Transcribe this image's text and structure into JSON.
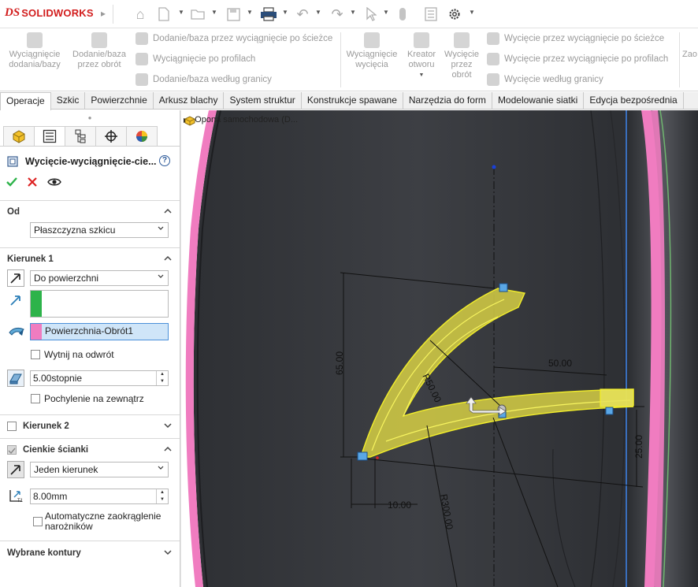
{
  "app": {
    "name": "SOLIDWORKS"
  },
  "quick_access": {
    "icons": [
      "home-icon",
      "new-icon",
      "open-icon",
      "save-icon",
      "print-icon",
      "undo-icon",
      "redo-icon",
      "select-icon",
      "rebuild-icon",
      "options-list-icon",
      "settings-icon"
    ]
  },
  "ribbon": {
    "boss_extrude": "Wyciągnięcie dodania/bazy",
    "revolve_boss": "Dodanie/baza przez obrót",
    "swept_boss": "Dodanie/baza przez wyciągnięcie po ścieżce",
    "lofted_boss": "Wyciągnięcie po profilach",
    "boundary_boss": "Dodanie/baza według granicy",
    "extruded_cut": "Wyciągnięcie wycięcia",
    "hole_wizard": "Kreator otworu",
    "revolved_cut": "Wycięcie przez obrót",
    "swept_cut": "Wycięcie przez wyciągnięcie po ścieżce",
    "lofted_cut": "Wycięcie przez wyciągnięcie po profilach",
    "boundary_cut": "Wycięcie według granicy",
    "zoom_partial": "Zao"
  },
  "tabs": [
    "Operacje",
    "Szkic",
    "Powierzchnie",
    "Arkusz blachy",
    "System struktur",
    "Konstrukcje spawane",
    "Narzędzia do form",
    "Modelowanie siatki",
    "Edycja bezpośrednia"
  ],
  "panel": {
    "title": "Wycięcie-wyciągnięcie-cie...",
    "from": {
      "header": "Od",
      "value": "Płaszczyzna szkicu"
    },
    "direction1": {
      "header": "Kierunek 1",
      "end_condition": "Do powierzchni",
      "face_value": "",
      "surface_value": "Powierzchnia-Obrót1",
      "flip_side_label": "Wytnij na odwrót",
      "draft_value": "5.00stopnie",
      "draft_outward_label": "Pochylenie na zewnątrz"
    },
    "direction2": {
      "header": "Kierunek 2"
    },
    "thin": {
      "header": "Cienkie ścianki",
      "type": "Jeden kierunek",
      "thickness": "8.00mm",
      "auto_fillet_label": "Automatyczne zaokrąglenie narożników"
    },
    "contours": {
      "header": "Wybrane kontury"
    }
  },
  "viewport": {
    "tree_label": "Opona samochodowa (D...",
    "dims": {
      "d65": "65.00",
      "r50": "R50.00",
      "d50": "50.00",
      "d25": "25.00",
      "d10": "10.00",
      "r300": "R300.00"
    }
  },
  "colors": {
    "accent_green": "#2db34a",
    "surface_pink": "#f07cc0",
    "sketch_yellow": "#f2ee2a",
    "tire_dark": "#3a3c41"
  }
}
